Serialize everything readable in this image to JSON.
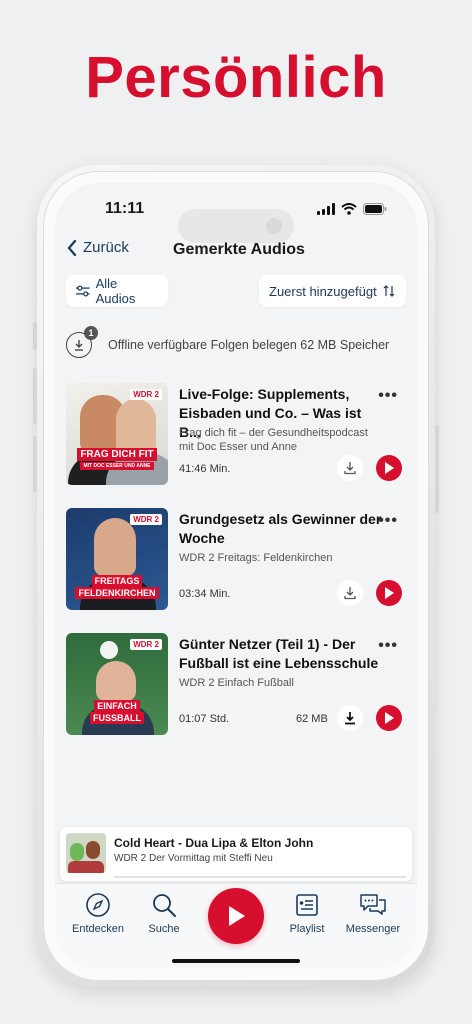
{
  "headline": "Persönlich",
  "status": {
    "time": "11:11"
  },
  "nav": {
    "back_label": "Zurück",
    "title": "Gemerkte Audios"
  },
  "filters": {
    "all_label": "Alle Audios",
    "sort_label": "Zuerst hinzugefügt"
  },
  "offline": {
    "badge": "1",
    "text": "Offline verfügbare Folgen belegen 62 MB Speicher"
  },
  "items": [
    {
      "title": "Live-Folge: Supplements, Eisbaden und Co. – Was ist B...",
      "subtitle": "Frag dich fit – der Gesundheitspodcast mit Doc Esser und Anne",
      "duration": "41:46 Min.",
      "size": "",
      "thumb_logo": "WDR 2",
      "thumb_label": "FRAG DICH FIT",
      "thumb_sublabel": "MIT DOC ESSER UND ANNE"
    },
    {
      "title": "Grundgesetz als Gewinner der Woche",
      "subtitle": "WDR 2 Freitags: Feldenkirchen",
      "duration": "03:34 Min.",
      "size": "",
      "thumb_logo": "WDR 2",
      "thumb_label": "FREITAGS",
      "thumb_sublabel": "FELDENKIRCHEN"
    },
    {
      "title": "Günter Netzer (Teil 1) - Der Fußball ist eine Lebensschule",
      "subtitle": "WDR 2 Einfach Fußball",
      "duration": "01:07 Std.",
      "size": "62 MB",
      "thumb_logo": "WDR 2",
      "thumb_label": "EINFACH",
      "thumb_sublabel": "FUSSBALL"
    }
  ],
  "mini_player": {
    "title": "Cold Heart - Dua Lipa & Elton John",
    "subtitle": "WDR 2 Der Vormittag mit Steffi Neu"
  },
  "tabs": {
    "discover": "Entdecken",
    "search": "Suche",
    "playlist": "Playlist",
    "messenger": "Messenger"
  },
  "colors": {
    "accent": "#d70f2e",
    "navy": "#1a3a5c",
    "screen_bg": "#f3f4f6"
  }
}
